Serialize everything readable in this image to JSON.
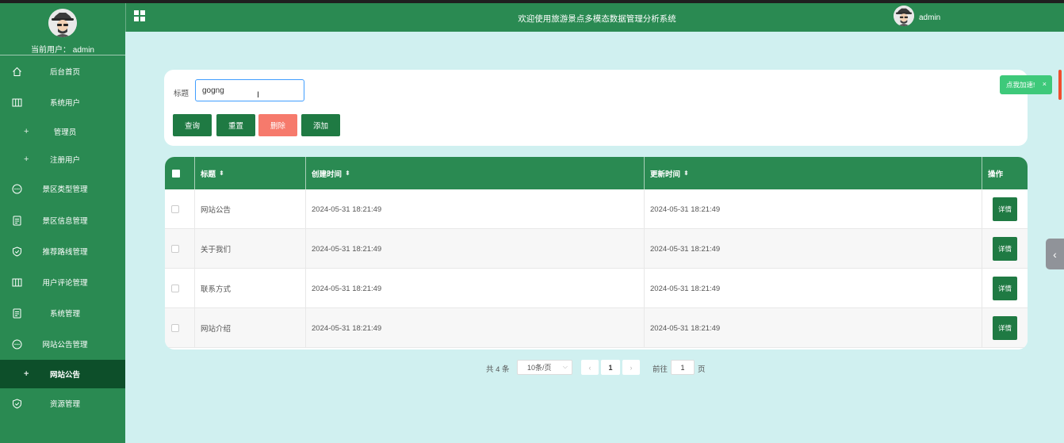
{
  "header": {
    "title": "欢迎使用旅游景点多模态数据管理分析系统",
    "user": "admin"
  },
  "sidebar": {
    "current_user": "当前用户： admin",
    "items": [
      {
        "label": "后台首页",
        "icon": "home-icon",
        "sub": false
      },
      {
        "label": "系统用户",
        "icon": "columns-icon",
        "sub": false
      },
      {
        "label": "管理员",
        "icon": "plus-icon",
        "sub": true
      },
      {
        "label": "注册用户",
        "icon": "plus-icon",
        "sub": true
      },
      {
        "label": "景区类型管理",
        "icon": "chat-icon",
        "sub": false
      },
      {
        "label": "景区信息管理",
        "icon": "document-icon",
        "sub": false
      },
      {
        "label": "推荐路线管理",
        "icon": "shield-check-icon",
        "sub": false
      },
      {
        "label": "用户评论管理",
        "icon": "columns-icon",
        "sub": false
      },
      {
        "label": "系统管理",
        "icon": "document-icon",
        "sub": false
      },
      {
        "label": "网站公告管理",
        "icon": "chat-icon",
        "sub": false
      },
      {
        "label": "网站公告",
        "icon": "plus-icon",
        "sub": true,
        "active": true
      },
      {
        "label": "资源管理",
        "icon": "shield-check-icon",
        "sub": false
      }
    ]
  },
  "search": {
    "label": "标题",
    "value": "gogng",
    "buttons": {
      "query": "查询",
      "reset": "重置",
      "delete": "删除",
      "add": "添加"
    }
  },
  "table": {
    "columns": {
      "title": "标题",
      "created": "创建时间",
      "updated": "更新时间",
      "actions": "操作"
    },
    "rows": [
      {
        "title": "网站公告",
        "created": "2024-05-31 18:21:49",
        "updated": "2024-05-31 18:21:49",
        "action": "详情"
      },
      {
        "title": "关于我们",
        "created": "2024-05-31 18:21:49",
        "updated": "2024-05-31 18:21:49",
        "action": "详情"
      },
      {
        "title": "联系方式",
        "created": "2024-05-31 18:21:49",
        "updated": "2024-05-31 18:21:49",
        "action": "详情"
      },
      {
        "title": "网站介绍",
        "created": "2024-05-31 18:21:49",
        "updated": "2024-05-31 18:21:49",
        "action": "详情"
      }
    ]
  },
  "pagination": {
    "total": "共 4 条",
    "page_size": "10条/页",
    "current_page": "1",
    "goto_label": "前往",
    "goto_value": "1",
    "page_suffix": "页"
  },
  "toast": {
    "text": "点我加速!",
    "close": "×"
  },
  "colors": {
    "primary": "#2a8a52",
    "dark": "#0d4f2a",
    "danger": "#f67a6c",
    "background": "#d0f0f0",
    "toast": "#3ec97a"
  }
}
